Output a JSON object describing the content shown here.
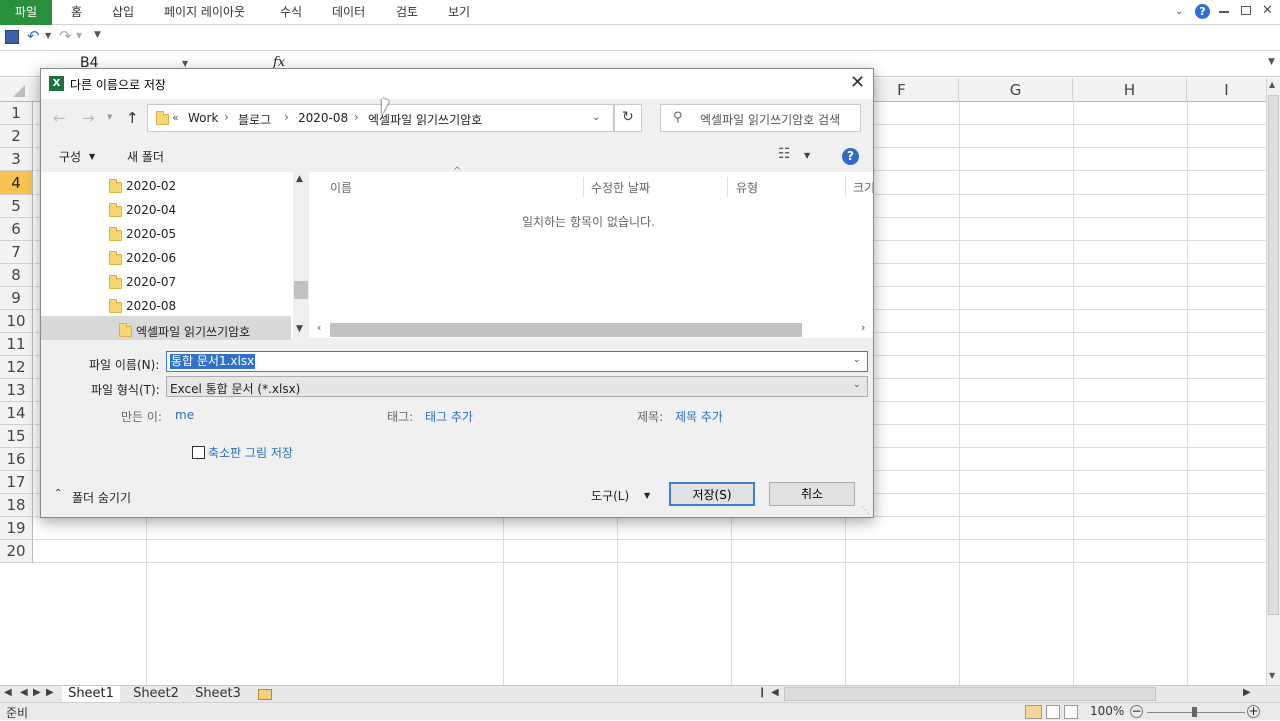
{
  "ribbon": {
    "tabs": [
      "파일",
      "홈",
      "삽입",
      "페이지 레이아웃",
      "수식",
      "데이터",
      "검토",
      "보기"
    ]
  },
  "formula_bar": {
    "name_box": "B4",
    "fx": "fx"
  },
  "grid": {
    "columns": [
      "F",
      "G",
      "H",
      "I"
    ],
    "rows": [
      "1",
      "2",
      "3",
      "4",
      "5",
      "6",
      "7",
      "8",
      "9",
      "10",
      "11",
      "12",
      "13",
      "14",
      "15",
      "16",
      "17",
      "18",
      "19",
      "20"
    ],
    "selected_row": "4"
  },
  "sheets": [
    "Sheet1",
    "Sheet2",
    "Sheet3"
  ],
  "status": {
    "ready": "준비",
    "zoom": "100%"
  },
  "dialog": {
    "title": "다른 이름으로 저장",
    "breadcrumb": [
      "«",
      "Work",
      "블로그",
      "2020-08",
      "엑셀파일 읽기쓰기암호"
    ],
    "search_placeholder": "엑셀파일 읽기쓰기암호 검색",
    "toolbar": {
      "organize": "구성",
      "new_folder": "새 폴더",
      "help": "?"
    },
    "nav_items": [
      "2020-02",
      "2020-04",
      "2020-05",
      "2020-06",
      "2020-07",
      "2020-08",
      "엑셀파일 읽기쓰기암호"
    ],
    "file_columns": [
      "이름",
      "수정한 날짜",
      "유형",
      "크기"
    ],
    "empty_message": "일치하는 항목이 없습니다.",
    "filename_label": "파일 이름(N):",
    "filename_value": "통합 문서1.xlsx",
    "filetype_label": "파일 형식(T):",
    "filetype_value": "Excel 통합 문서 (*.xlsx)",
    "author_label": "만든 이:",
    "author_value": "me",
    "tags_label": "태그:",
    "tags_value": "태그 추가",
    "title_label": "제목:",
    "title_value": "제목 추가",
    "thumbnail_label": "축소판 그림 저장",
    "hide_folders": "폴더 숨기기",
    "tools_label": "도구(L)",
    "save_label": "저장(S)",
    "cancel_label": "취소"
  }
}
